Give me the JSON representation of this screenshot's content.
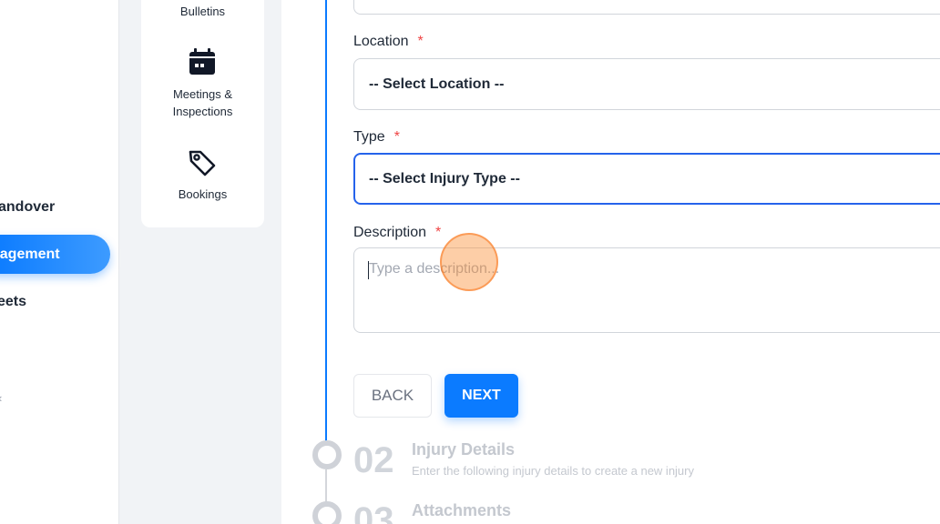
{
  "sidebar": {
    "items": [
      {
        "label": "andover"
      },
      {
        "label": "nagement"
      },
      {
        "label": "eets"
      }
    ],
    "tick": "‹"
  },
  "quick_nav": {
    "bulletins": "Bulletins",
    "meetings_line1": "Meetings &",
    "meetings_line2": "Inspections",
    "bookings": "Bookings"
  },
  "form": {
    "location_label": "Location",
    "location_value": "-- Select Location --",
    "type_label": "Type",
    "type_value": "-- Select Injury Type --",
    "description_label": "Description",
    "description_placeholder": "Type a description...",
    "required_mark": "*",
    "back_label": "BACK",
    "next_label": "NEXT"
  },
  "steps": [
    {
      "number": "02",
      "title": "Injury Details",
      "subtitle": "Enter the following injury details to create a new injury"
    },
    {
      "number": "03",
      "title": "Attachments",
      "subtitle": ""
    }
  ],
  "colors": {
    "accent": "#0b7bff",
    "required": "#ef4444",
    "focus_border": "#2563eb"
  }
}
